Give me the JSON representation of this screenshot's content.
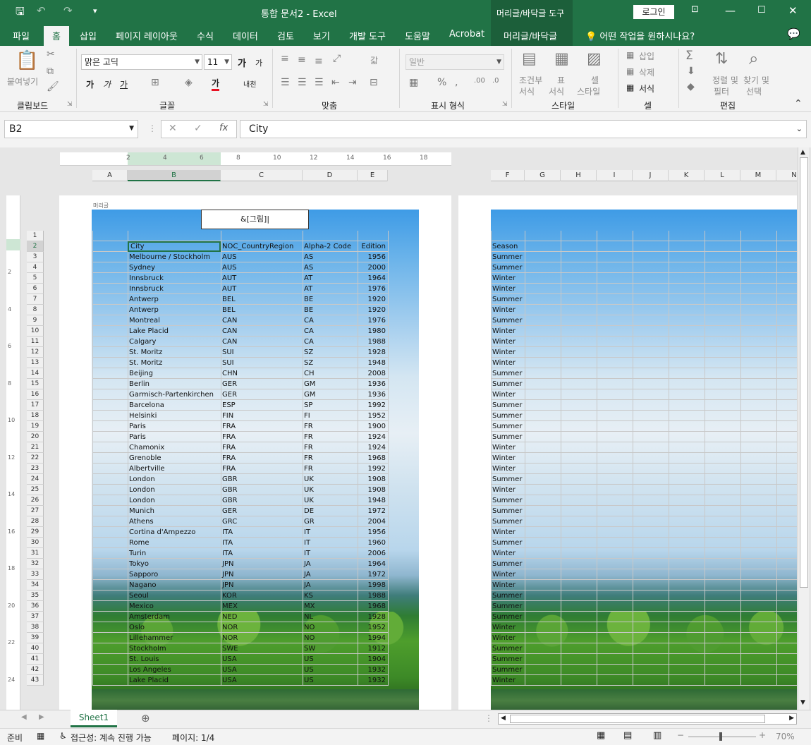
{
  "window": {
    "title": "통합 문서2  -  Excel",
    "context_tool": "머리글/바닥글 도구",
    "login": "로그인"
  },
  "tabs": [
    "파일",
    "홈",
    "삽입",
    "페이지 레이아웃",
    "수식",
    "데이터",
    "검토",
    "보기",
    "개발 도구",
    "도움말",
    "Acrobat"
  ],
  "context_tab": "머리글/바닥글",
  "tell_me": "어떤 작업을 원하시나요?",
  "ribbon": {
    "clipboard": {
      "label": "클립보드",
      "paste": "붙여넣기"
    },
    "font": {
      "label": "글꼴",
      "name": "맑은 고딕",
      "size": "11",
      "bold": "가",
      "italic": "가",
      "underline": "가",
      "color_letter": "가",
      "grow": "가",
      "shrink": "가",
      "phonetic": "내천"
    },
    "align": {
      "label": "맞춤",
      "wrap": "갋"
    },
    "number": {
      "label": "표시 형식",
      "format": "일반"
    },
    "styles": {
      "label": "스타일",
      "cond1": "조건부",
      "cond2": "서식",
      "table1": "표",
      "table2": "서식",
      "cell1": "셀",
      "cell2": "스타일"
    },
    "cells": {
      "label": "셀",
      "insert": "삽입",
      "delete": "삭제",
      "format": "서식"
    },
    "editing": {
      "label": "편집",
      "sort1": "정렬 및",
      "sort2": "필터",
      "find1": "찾기 및",
      "find2": "선택"
    }
  },
  "formula_bar": {
    "name_box": "B2",
    "value": "City"
  },
  "rulers": {
    "h_left": [
      "2",
      "4",
      "6",
      "8",
      "10",
      "12",
      "14",
      "16",
      "18"
    ],
    "v_left": [
      "2",
      "4",
      "6",
      "8",
      "10",
      "12",
      "14",
      "16",
      "18",
      "20",
      "22",
      "24"
    ]
  },
  "columns_left": [
    "A",
    "B",
    "C",
    "D",
    "E"
  ],
  "columns_right": [
    "F",
    "G",
    "H",
    "I",
    "J",
    "K",
    "L",
    "M",
    "N"
  ],
  "header_label": "머리글",
  "header_code": "&[그림]",
  "rows": [
    {
      "n": "1",
      "b": "",
      "c": "",
      "d": "",
      "e": "",
      "f": ""
    },
    {
      "n": "2",
      "b": "City",
      "c": "NOC_CountryRegion",
      "d": "Alpha-2 Code",
      "e": "Edition",
      "f": "Season"
    },
    {
      "n": "3",
      "b": "Melbourne / Stockholm",
      "c": "AUS",
      "d": "AS",
      "e": "1956",
      "f": "Summer"
    },
    {
      "n": "4",
      "b": "Sydney",
      "c": "AUS",
      "d": "AS",
      "e": "2000",
      "f": "Summer"
    },
    {
      "n": "5",
      "b": "Innsbruck",
      "c": "AUT",
      "d": "AT",
      "e": "1964",
      "f": "Winter"
    },
    {
      "n": "6",
      "b": "Innsbruck",
      "c": "AUT",
      "d": "AT",
      "e": "1976",
      "f": "Winter"
    },
    {
      "n": "7",
      "b": "Antwerp",
      "c": "BEL",
      "d": "BE",
      "e": "1920",
      "f": "Summer"
    },
    {
      "n": "8",
      "b": "Antwerp",
      "c": "BEL",
      "d": "BE",
      "e": "1920",
      "f": "Winter"
    },
    {
      "n": "9",
      "b": "Montreal",
      "c": "CAN",
      "d": "CA",
      "e": "1976",
      "f": "Summer"
    },
    {
      "n": "10",
      "b": "Lake Placid",
      "c": "CAN",
      "d": "CA",
      "e": "1980",
      "f": "Winter"
    },
    {
      "n": "11",
      "b": "Calgary",
      "c": "CAN",
      "d": "CA",
      "e": "1988",
      "f": "Winter"
    },
    {
      "n": "12",
      "b": "St. Moritz",
      "c": "SUI",
      "d": "SZ",
      "e": "1928",
      "f": "Winter"
    },
    {
      "n": "13",
      "b": "St. Moritz",
      "c": "SUI",
      "d": "SZ",
      "e": "1948",
      "f": "Winter"
    },
    {
      "n": "14",
      "b": "Beijing",
      "c": "CHN",
      "d": "CH",
      "e": "2008",
      "f": "Summer"
    },
    {
      "n": "15",
      "b": "Berlin",
      "c": "GER",
      "d": "GM",
      "e": "1936",
      "f": "Summer"
    },
    {
      "n": "16",
      "b": "Garmisch-Partenkirchen",
      "c": "GER",
      "d": "GM",
      "e": "1936",
      "f": "Winter"
    },
    {
      "n": "17",
      "b": "Barcelona",
      "c": "ESP",
      "d": "SP",
      "e": "1992",
      "f": "Summer"
    },
    {
      "n": "18",
      "b": "Helsinki",
      "c": "FIN",
      "d": "FI",
      "e": "1952",
      "f": "Summer"
    },
    {
      "n": "19",
      "b": "Paris",
      "c": "FRA",
      "d": "FR",
      "e": "1900",
      "f": "Summer"
    },
    {
      "n": "20",
      "b": "Paris",
      "c": "FRA",
      "d": "FR",
      "e": "1924",
      "f": "Summer"
    },
    {
      "n": "21",
      "b": "Chamonix",
      "c": "FRA",
      "d": "FR",
      "e": "1924",
      "f": "Winter"
    },
    {
      "n": "22",
      "b": "Grenoble",
      "c": "FRA",
      "d": "FR",
      "e": "1968",
      "f": "Winter"
    },
    {
      "n": "23",
      "b": "Albertville",
      "c": "FRA",
      "d": "FR",
      "e": "1992",
      "f": "Winter"
    },
    {
      "n": "24",
      "b": "London",
      "c": "GBR",
      "d": "UK",
      "e": "1908",
      "f": "Summer"
    },
    {
      "n": "25",
      "b": "London",
      "c": "GBR",
      "d": "UK",
      "e": "1908",
      "f": "Winter"
    },
    {
      "n": "26",
      "b": "London",
      "c": "GBR",
      "d": "UK",
      "e": "1948",
      "f": "Summer"
    },
    {
      "n": "27",
      "b": "Munich",
      "c": "GER",
      "d": "DE",
      "e": "1972",
      "f": "Summer"
    },
    {
      "n": "28",
      "b": "Athens",
      "c": "GRC",
      "d": "GR",
      "e": "2004",
      "f": "Summer"
    },
    {
      "n": "29",
      "b": "Cortina d'Ampezzo",
      "c": "ITA",
      "d": "IT",
      "e": "1956",
      "f": "Winter"
    },
    {
      "n": "30",
      "b": "Rome",
      "c": "ITA",
      "d": "IT",
      "e": "1960",
      "f": "Summer"
    },
    {
      "n": "31",
      "b": "Turin",
      "c": "ITA",
      "d": "IT",
      "e": "2006",
      "f": "Winter"
    },
    {
      "n": "32",
      "b": "Tokyo",
      "c": "JPN",
      "d": "JA",
      "e": "1964",
      "f": "Summer"
    },
    {
      "n": "33",
      "b": "Sapporo",
      "c": "JPN",
      "d": "JA",
      "e": "1972",
      "f": "Winter"
    },
    {
      "n": "34",
      "b": "Nagano",
      "c": "JPN",
      "d": "JA",
      "e": "1998",
      "f": "Winter"
    },
    {
      "n": "35",
      "b": "Seoul",
      "c": "KOR",
      "d": "KS",
      "e": "1988",
      "f": "Summer"
    },
    {
      "n": "36",
      "b": "Mexico",
      "c": "MEX",
      "d": "MX",
      "e": "1968",
      "f": "Summer"
    },
    {
      "n": "37",
      "b": "Amsterdam",
      "c": "NED",
      "d": "NL",
      "e": "1928",
      "f": "Summer"
    },
    {
      "n": "38",
      "b": "Oslo",
      "c": "NOR",
      "d": "NO",
      "e": "1952",
      "f": "Winter"
    },
    {
      "n": "39",
      "b": "Lillehammer",
      "c": "NOR",
      "d": "NO",
      "e": "1994",
      "f": "Winter"
    },
    {
      "n": "40",
      "b": "Stockholm",
      "c": "SWE",
      "d": "SW",
      "e": "1912",
      "f": "Summer"
    },
    {
      "n": "41",
      "b": "St. Louis",
      "c": "USA",
      "d": "US",
      "e": "1904",
      "f": "Summer"
    },
    {
      "n": "42",
      "b": "Los Angeles",
      "c": "USA",
      "d": "US",
      "e": "1932",
      "f": "Summer"
    },
    {
      "n": "43",
      "b": "Lake Placid",
      "c": "USA",
      "d": "US",
      "e": "1932",
      "f": "Winter"
    }
  ],
  "sheet_tab": "Sheet1",
  "status": {
    "ready": "준비",
    "accessibility": "접근성: 계속 진행 가능",
    "page": "페이지: 1/4",
    "zoom": "70%"
  }
}
